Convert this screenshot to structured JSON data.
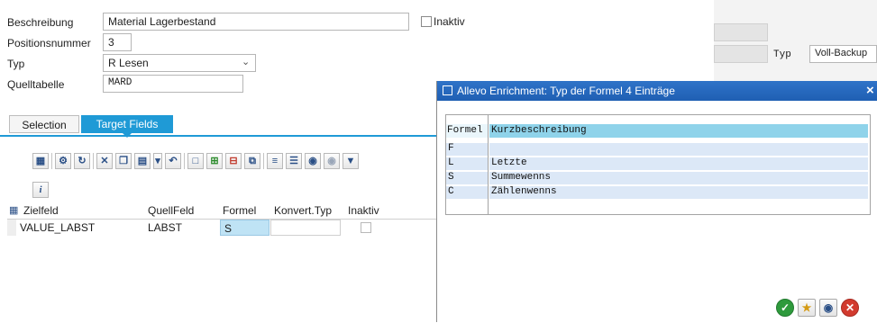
{
  "form": {
    "beschreibung_label": "Beschreibung",
    "beschreibung_value": "Material Lagerbestand",
    "inaktiv_label": "Inaktiv",
    "positionsnummer_label": "Positionsnummer",
    "positionsnummer_value": "3",
    "typ_label": "Typ",
    "typ_value": "R Lesen",
    "quelltabelle_label": "Quelltabelle",
    "quelltabelle_value": "MARD"
  },
  "right_panel": {
    "typ_label": "Typ",
    "typ_value": "Voll-Backup"
  },
  "tabs": [
    {
      "label": "Selection"
    },
    {
      "label": "Target Fields"
    }
  ],
  "grid": {
    "columns": [
      "Zielfeld",
      "QuellFeld",
      "Formel",
      "Konvert.Typ",
      "Inaktiv"
    ],
    "rows": [
      {
        "zielfeld": "VALUE_LABST",
        "quellfeld": "LABST",
        "formel": "S",
        "konvert": "",
        "inaktiv": false
      }
    ]
  },
  "popup": {
    "title": "Allevo Enrichment: Typ der Formel 4 Einträge",
    "close": "×",
    "columns": [
      "Formel",
      "Kurzbeschreibung"
    ],
    "rows": [
      {
        "code": "F",
        "desc": ""
      },
      {
        "code": "L",
        "desc": "Letzte"
      },
      {
        "code": "S",
        "desc": "Summewenns"
      },
      {
        "code": "C",
        "desc": "Zählenwenns"
      }
    ]
  },
  "colors": {
    "accent": "#1f5fb3",
    "tab_active": "#1f9ad6",
    "popup_header": "#8fd3ea",
    "list_row": "#dce8f7"
  }
}
